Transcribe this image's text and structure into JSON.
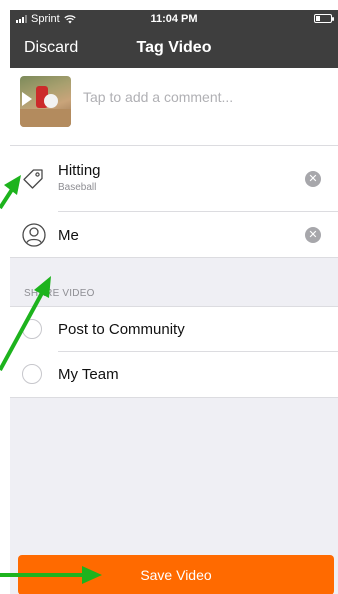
{
  "status_bar": {
    "carrier": "Sprint",
    "time": "11:04 PM",
    "battery_level": 0.25
  },
  "nav": {
    "discard_label": "Discard",
    "title": "Tag Video"
  },
  "comment": {
    "placeholder": "Tap to add a comment...",
    "value": ""
  },
  "tags": [
    {
      "icon": "tag-icon",
      "title": "Hitting",
      "subtitle": "Baseball",
      "clear_icon": "clear-icon"
    },
    {
      "icon": "person-icon",
      "title": "Me",
      "clear_icon": "clear-icon"
    }
  ],
  "share": {
    "header": "SHARE VIDEO",
    "options": [
      {
        "label": "Post to Community",
        "selected": false
      },
      {
        "label": "My Team",
        "selected": false
      }
    ]
  },
  "save_label": "Save Video",
  "colors": {
    "nav_bg": "#3e3e3e",
    "accent": "#ff6a00",
    "annotation_arrow": "#1db31d"
  }
}
